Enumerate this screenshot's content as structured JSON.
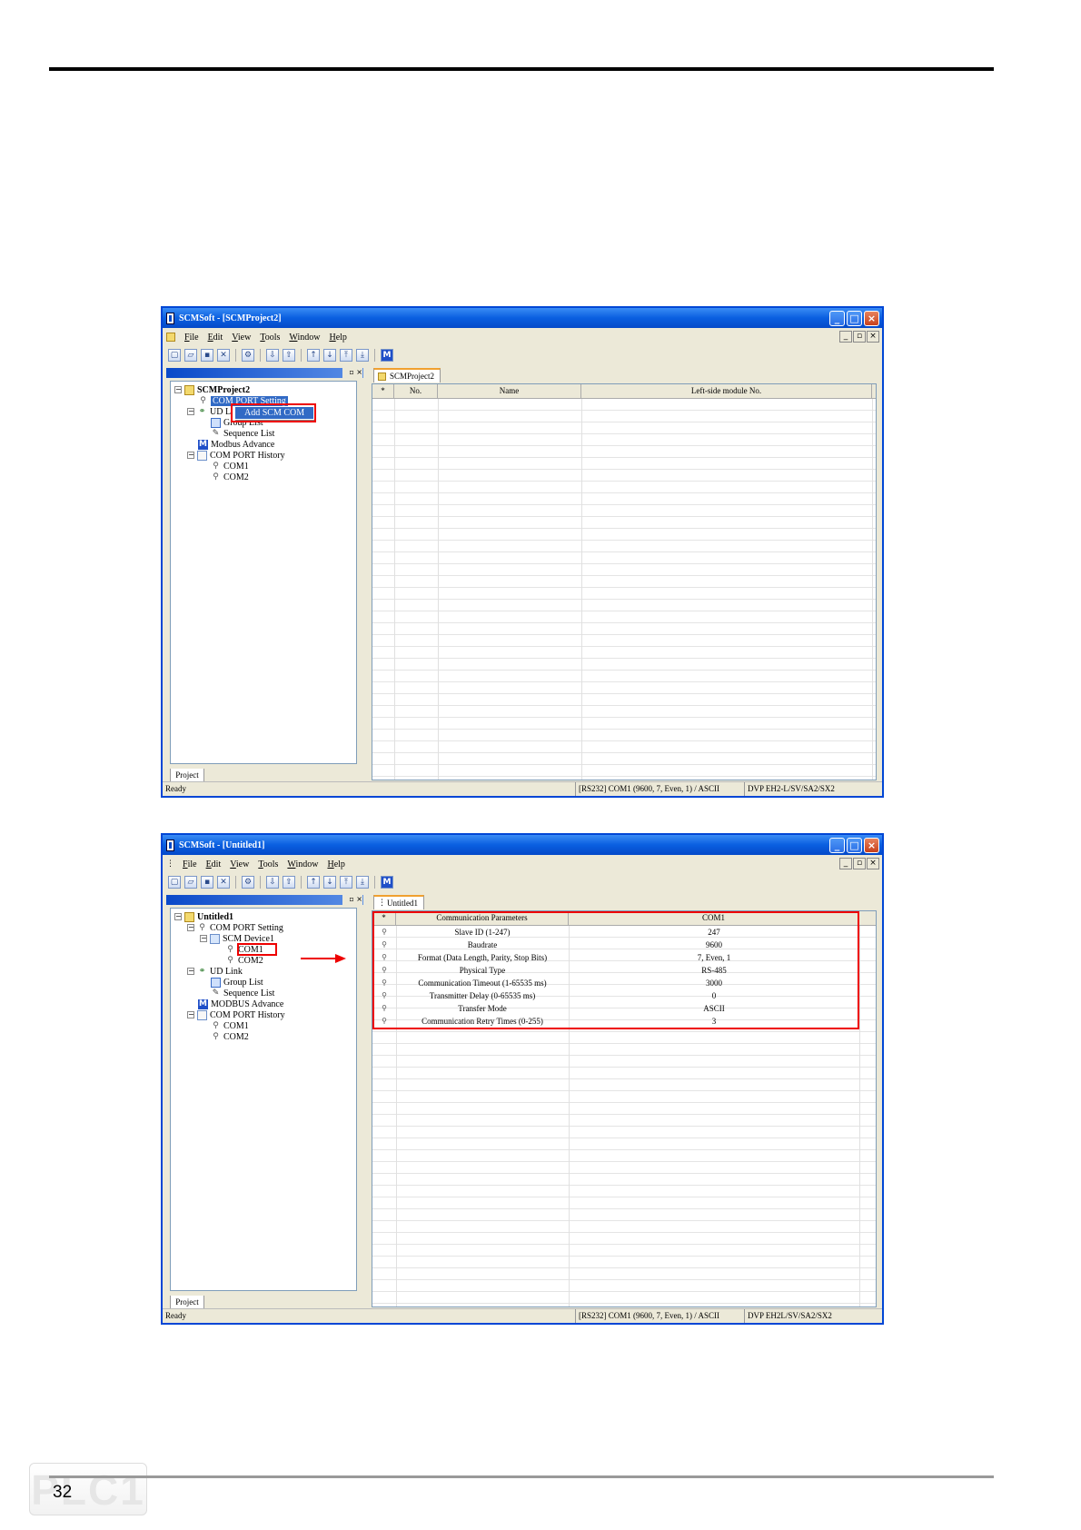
{
  "page": {
    "number": "32",
    "watermark": "PLC1"
  },
  "window1": {
    "title": "SCMSoft - [SCMProject2]",
    "menu": [
      "File",
      "Edit",
      "View",
      "Tools",
      "Window",
      "Help"
    ],
    "tree": {
      "root": "SCMProject2",
      "com_port_setting": "COM PORT Setting",
      "context_menu": "Add SCM COM",
      "ud_link": "UD L",
      "group_list": "Group List",
      "sequence_list": "Sequence List",
      "modbus": "Modbus Advance",
      "history": "COM PORT History",
      "com1": "COM1",
      "com2": "COM2"
    },
    "pane_tab": "Project",
    "doc_tab": "SCMProject2",
    "columns": [
      "*",
      "No.",
      "Name",
      "Left-side module No."
    ],
    "status": {
      "ready": "Ready",
      "port": "[RS232] COM1 (9600, 7, Even, 1) / ASCII",
      "model": "DVP EH2-L/SV/SA2/SX2"
    }
  },
  "window2": {
    "title": "SCMSoft - [Untitled1]",
    "menu": [
      "File",
      "Edit",
      "View",
      "Tools",
      "Window",
      "Help"
    ],
    "tree": {
      "root": "Untitled1",
      "com_port_setting": "COM PORT Setting",
      "scm_device": "SCM Device1",
      "com1": "COM1",
      "com2": "COM2",
      "ud_link": "UD Link",
      "group_list": "Group List",
      "sequence_list": "Sequence List",
      "modbus": "MODBUS Advance",
      "history": "COM PORT History",
      "hcom1": "COM1",
      "hcom2": "COM2"
    },
    "pane_tab": "Project",
    "doc_tab": "Untitled1",
    "columns": [
      "*",
      "Communication Parameters",
      "COM1"
    ],
    "params": [
      {
        "name": "Slave ID (1-247)",
        "value": "247"
      },
      {
        "name": "Baudrate",
        "value": "9600"
      },
      {
        "name": "Format (Data Length, Parity, Stop Bits)",
        "value": "7, Even, 1"
      },
      {
        "name": "Physical Type",
        "value": "RS-485"
      },
      {
        "name": "Communication Timeout (1-65535 ms)",
        "value": "3000"
      },
      {
        "name": "Transmitter Delay (0-65535 ms)",
        "value": "0"
      },
      {
        "name": "Transfer Mode",
        "value": "ASCII"
      },
      {
        "name": "Communication Retry Times (0-255)",
        "value": "3"
      }
    ],
    "status": {
      "ready": "Ready",
      "port": "[RS232] COM1 (9600, 7, Even, 1) / ASCII",
      "model": "DVP EH2L/SV/SA2/SX2"
    }
  },
  "colors": {
    "titlebar": "#0a5fe0",
    "highlight": "#316ac5",
    "callout": "#e00000"
  }
}
